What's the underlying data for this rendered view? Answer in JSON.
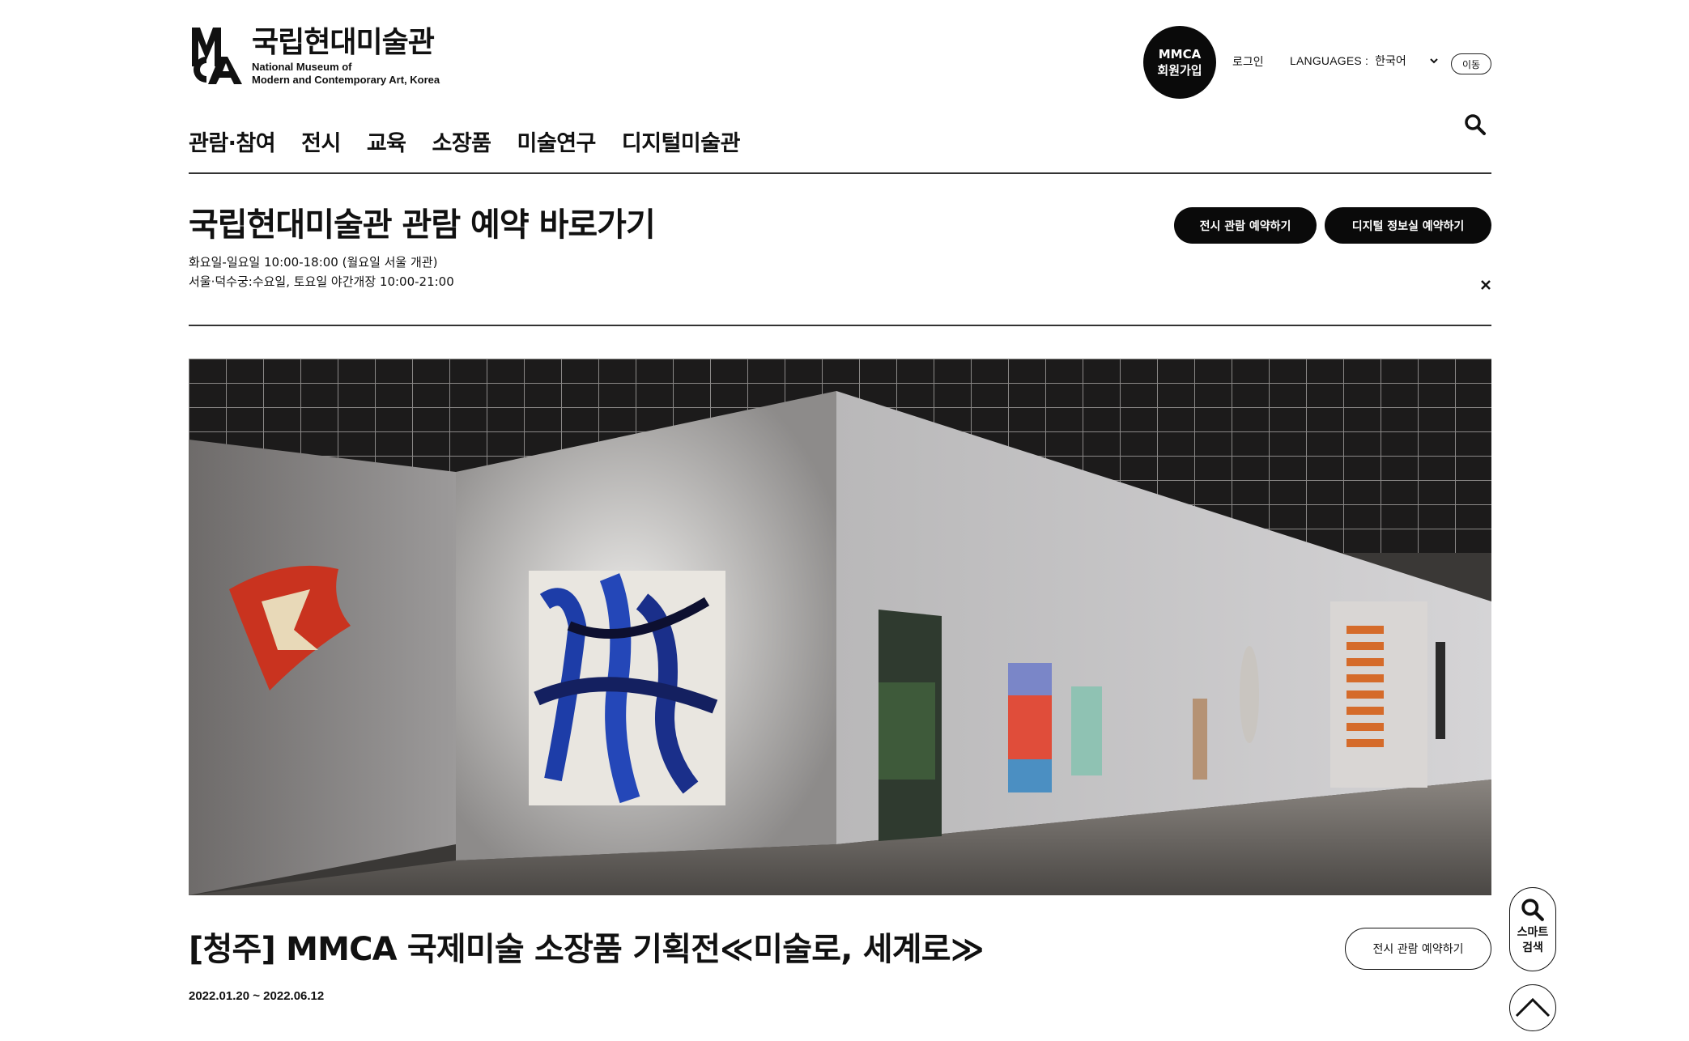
{
  "logo": {
    "korean_name": "국립현대미술관",
    "english_line1": "National Museum of",
    "english_line2": "Modern and Contemporary Art, Korea"
  },
  "header": {
    "join_line1": "MMCA",
    "join_line2": "회원가입",
    "login_label": "로그인",
    "language_label": "LANGUAGES : ",
    "language_value": "한국어",
    "go_label": "이동"
  },
  "nav": {
    "items": [
      {
        "label": "관람·참여"
      },
      {
        "label": "전시"
      },
      {
        "label": "교육"
      },
      {
        "label": "소장품"
      },
      {
        "label": "미술연구"
      },
      {
        "label": "디지털미술관"
      }
    ]
  },
  "reservation": {
    "title": "국립현대미술관 관람 예약 바로가기",
    "hours_line1": "화요일-일요일 10:00-18:00 (월요일 서울 개관)",
    "hours_line2": "서울·덕수궁:수요일, 토요일 야간개장 10:00-21:00",
    "exhibition_button": "전시 관람 예약하기",
    "digital_button": "디지털 정보실 예약하기"
  },
  "exhibition": {
    "title": "[청주] MMCA 국제미술 소장품 기획전≪미술로, 세계로≫",
    "date": "2022.01.20 ~ 2022.06.12",
    "reserve_button": "전시 관람 예약하기"
  },
  "floating": {
    "smart_search_label": "스마트 검색"
  },
  "colors": {
    "primary": "#0a0a0a",
    "background": "#ffffff",
    "divider": "#333333"
  }
}
